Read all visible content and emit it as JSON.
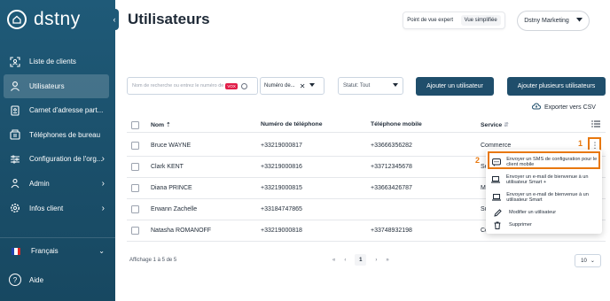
{
  "brand": {
    "name": "dstny"
  },
  "sidebar": {
    "items": [
      {
        "label": "Liste de clients",
        "icon": "scan-icon"
      },
      {
        "label": "Utilisateurs",
        "icon": "user-icon"
      },
      {
        "label": "Carnet d'adresse part...",
        "icon": "addressbook-icon"
      },
      {
        "label": "Téléphones de bureau",
        "icon": "deskphone-icon"
      },
      {
        "label": "Configuration de l'org...",
        "icon": "sliders-icon"
      },
      {
        "label": "Admin",
        "icon": "admin-icon"
      },
      {
        "label": "Infos client",
        "icon": "gear-icon"
      }
    ],
    "language": "Français",
    "help": "Aide"
  },
  "header": {
    "title": "Utilisateurs",
    "view_expert": "Point de vue expert",
    "view_simple": "Vue simplifiée",
    "account": "Dstny Marketing"
  },
  "filters": {
    "search_placeholder": "Nom de recherche ou entrez le numéro de",
    "search_pill": "VOX",
    "number_filter": "Numéro de...",
    "status": "Statut: Tout"
  },
  "actions": {
    "add_user": "Ajouter un utilisateur",
    "add_many": "Ajouter plusieurs utilisateurs",
    "export": "Exporter vers CSV"
  },
  "table": {
    "columns": [
      "Nom",
      "Numéro de téléphone",
      "Téléphone mobile",
      "Service"
    ],
    "rows": [
      {
        "name": "Bruce WAYNE",
        "phone": "+33219000817",
        "mobile": "+33666356282",
        "service": "Commerce"
      },
      {
        "name": "Clark KENT",
        "phone": "+33219000816",
        "mobile": "+33712345678",
        "service": "Se"
      },
      {
        "name": "Diana PRINCE",
        "phone": "+33219000815",
        "mobile": "+33663426787",
        "service": "M"
      },
      {
        "name": "Erwann Zachelle",
        "phone": "+33184747865",
        "mobile": "",
        "service": "Su"
      },
      {
        "name": "Natasha ROMANOFF",
        "phone": "+33219000818",
        "mobile": "+33748932198",
        "service": "Co"
      }
    ]
  },
  "menu": {
    "items": [
      "Envoyer un SMS de configuration pour le client mobile",
      "Envoyer un e-mail de bienvenue à un utilisateur Smart +",
      "Envoyer un e-mail de bienvenue à un utilisateur Smart",
      "Modifier un utilisateur",
      "Supprimer"
    ]
  },
  "callouts": [
    "1",
    "2"
  ],
  "pagination": {
    "info": "Affichage 1 à 5 de 5",
    "current": "1",
    "per_page": "10"
  },
  "colors": {
    "sidebar": "#1f5a78",
    "primary_button": "#1f4e6b",
    "highlight": "#e8780e"
  }
}
